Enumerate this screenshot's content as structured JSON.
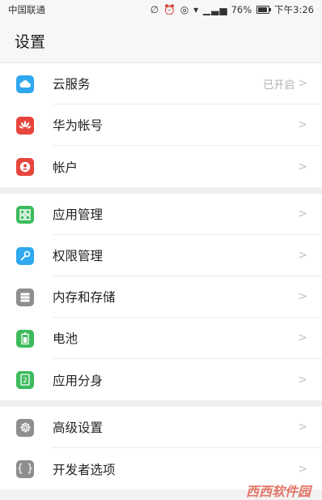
{
  "status_bar": {
    "carrier": "中国联通",
    "indicators": "∅ ⏰ 👁 ☰ ▐",
    "battery": "76%",
    "time": "下午3:26"
  },
  "header": {
    "title": "设置"
  },
  "groups": [
    {
      "items": [
        {
          "label": "云服务",
          "status": "已开启",
          "icon": "cloud-icon",
          "color": "#2fa8f0"
        },
        {
          "label": "华为帐号",
          "icon": "huawei-logo-icon",
          "color": "#e8453c"
        },
        {
          "label": "帐户",
          "icon": "account-icon",
          "color": "#e8453c"
        }
      ]
    },
    {
      "items": [
        {
          "label": "应用管理",
          "icon": "app-grid-icon",
          "color": "#3dbb5c"
        },
        {
          "label": "权限管理",
          "icon": "key-icon",
          "color": "#2fa8f0"
        },
        {
          "label": "内存和存储",
          "icon": "storage-icon",
          "color": "#8e8e8e"
        },
        {
          "label": "电池",
          "icon": "battery-icon",
          "color": "#3dbb5c"
        },
        {
          "label": "应用分身",
          "icon": "app-twin-icon",
          "color": "#3dbb5c"
        }
      ]
    },
    {
      "items": [
        {
          "label": "高级设置",
          "icon": "gear-icon",
          "color": "#8e8e8e"
        },
        {
          "label": "开发者选项",
          "icon": "braces-icon",
          "color": "#8e8e8e"
        }
      ]
    }
  ],
  "chevron": ">",
  "watermark": "西西软件园"
}
